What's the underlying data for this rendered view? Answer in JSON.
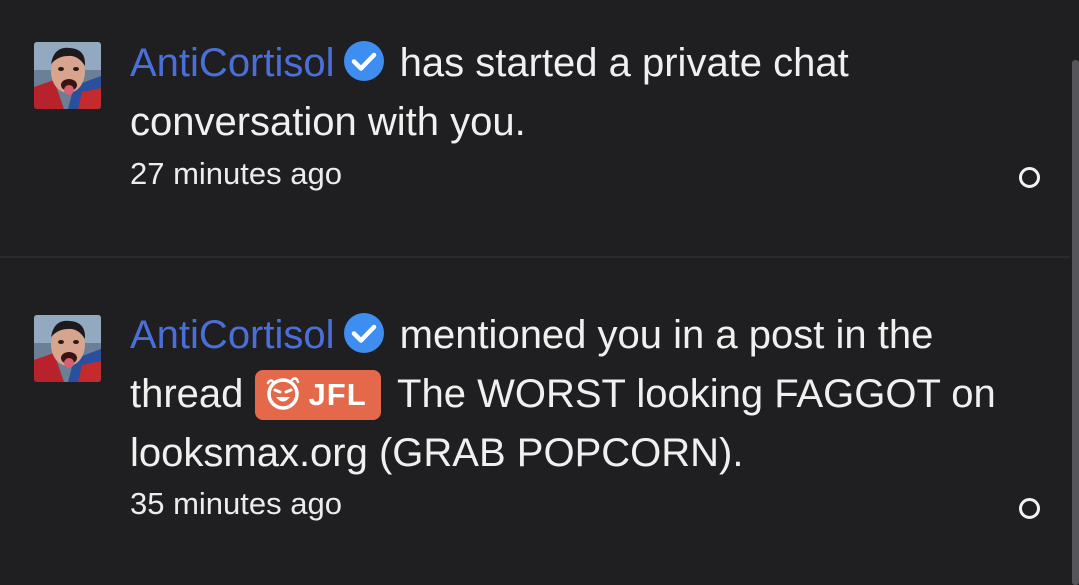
{
  "alerts": [
    {
      "username": "AntiCortisol",
      "verified_icon": "verified-badge-icon",
      "action_text": " has started a private chat conversation with you.",
      "time": "27 minutes ago",
      "mark_read_icon": "circle-outline-icon"
    },
    {
      "username": "AntiCortisol",
      "verified_icon": "verified-badge-icon",
      "action_text_before": " mentioned you in a post in the thread ",
      "thread_prefix": "JFL",
      "thread_prefix_icon": "laughing-face-icon",
      "thread_title": " The WORST looking FAGGOT on looksmax.org (GRAB POPCORN).",
      "time": "35 minutes ago",
      "mark_read_icon": "circle-outline-icon"
    }
  ],
  "colors": {
    "background": "#1f1f21",
    "username": "#4a6fd8",
    "verified_badge": "#3d8ef0",
    "prefix_badge": "#e4694a",
    "text": "#f0f0f0"
  }
}
